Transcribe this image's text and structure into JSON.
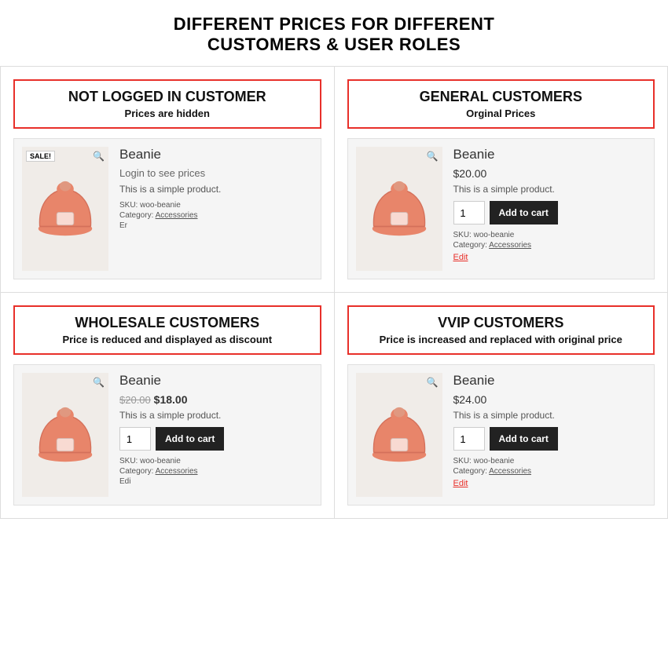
{
  "page": {
    "title": "DIFFERENT PRICES FOR DIFFERENT\nCUSTOMERS & USER ROLES"
  },
  "cells": [
    {
      "id": "not-logged-in",
      "role_title": "NOT LOGGED IN CUSTOMER",
      "role_sub": "Prices are hidden",
      "show_sale_badge": true,
      "show_price": false,
      "login_msg": "Login to see prices",
      "show_add_to_cart": false,
      "product_name": "Beanie",
      "description": "This is a simple product.",
      "sku": "SKU: woo-beanie",
      "category": "Category:",
      "category_link": "Accessories",
      "extra": "Er",
      "edit_link": null
    },
    {
      "id": "general-customers",
      "role_title": "GENERAL CUSTOMERS",
      "role_sub": "Orginal Prices",
      "show_sale_badge": false,
      "show_price": true,
      "price": "$20.00",
      "show_add_to_cart": true,
      "product_name": "Beanie",
      "description": "This is a simple product.",
      "sku": "SKU: woo-beanie",
      "category": "Category:",
      "category_link": "Accessories",
      "extra": null,
      "edit_link": "Edit"
    },
    {
      "id": "wholesale-customers",
      "role_title": "WHOLESALE CUSTOMERS",
      "role_sub": "Price is reduced and displayed as discount",
      "show_sale_badge": false,
      "show_price": true,
      "price_original": "$20.00",
      "price": "$18.00",
      "show_add_to_cart": true,
      "product_name": "Beanie",
      "description": "This is a simple product.",
      "sku": "SKU: woo-beanie",
      "category": "Category:",
      "category_link": "Accessories",
      "extra": "Edi",
      "edit_link": null
    },
    {
      "id": "vvip-customers",
      "role_title": "VVIP CUSTOMERS",
      "role_sub": "Price is increased and replaced with original price",
      "show_sale_badge": false,
      "show_price": true,
      "price": "$24.00",
      "show_add_to_cart": true,
      "product_name": "Beanie",
      "description": "This is a simple product.",
      "sku": "SKU: woo-beanie",
      "category": "Category:",
      "category_link": "Accessories",
      "extra": null,
      "edit_link": "Edit"
    }
  ],
  "labels": {
    "add_to_cart": "Add to cart",
    "qty": "1",
    "sale": "SALE!",
    "zoom": "🔍"
  }
}
